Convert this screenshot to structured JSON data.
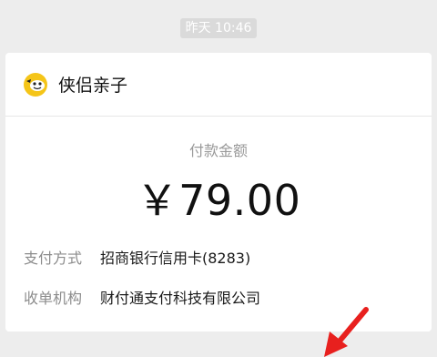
{
  "timestamp": "昨天 10:46",
  "merchant": {
    "name": "侠侣亲子",
    "logo_icon": "smiley-mascot-icon"
  },
  "payment": {
    "amount_label": "付款金额",
    "amount": "￥79.00"
  },
  "details": [
    {
      "label": "支付方式",
      "value": "招商银行信用卡(8283)"
    },
    {
      "label": "收单机构",
      "value": "财付通支付科技有限公司"
    }
  ],
  "colors": {
    "background": "#ededed",
    "card": "#ffffff",
    "arrow": "#e8201e",
    "logo": "#f5c518"
  }
}
